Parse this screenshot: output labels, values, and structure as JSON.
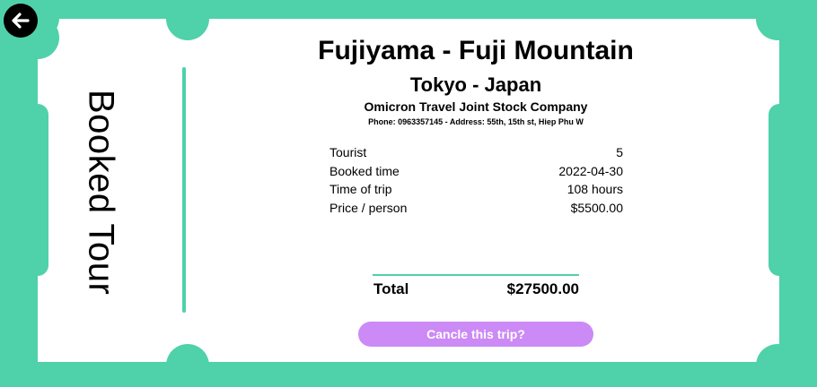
{
  "page": {
    "vertical_title": "Booked Tour"
  },
  "tour": {
    "name": "Fujiyama - Fuji Mountain",
    "location": "Tokyo - Japan",
    "company": "Omicron Travel Joint Stock Company",
    "contact": "Phone: 0963357145 - Address: 55th, 15th st, Hiep Phu W"
  },
  "details": [
    {
      "label": "Tourist",
      "value": "5"
    },
    {
      "label": "Booked time",
      "value": "2022-04-30"
    },
    {
      "label": "Time of trip",
      "value": "108 hours"
    },
    {
      "label": "Price / person",
      "value": "$5500.00"
    }
  ],
  "total": {
    "label": "Total",
    "value": "$27500.00"
  },
  "actions": {
    "cancel_label": "Cancle this trip?"
  },
  "icons": {
    "back": "arrow-left-icon"
  },
  "colors": {
    "background": "#4fd1aa",
    "ticket": "#ffffff",
    "accent": "#4fd1aa",
    "cancel_button": "#cb8af5",
    "text": "#000000"
  }
}
